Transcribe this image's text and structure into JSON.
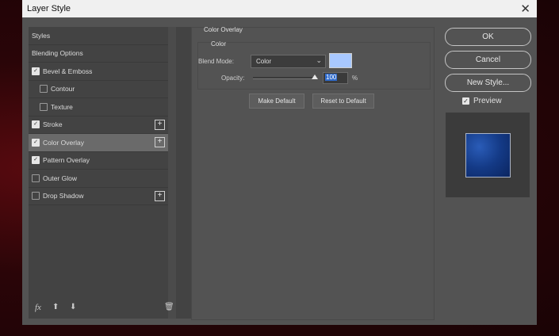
{
  "dialog": {
    "title": "Layer Style"
  },
  "styles_list": [
    {
      "label": "Styles",
      "checkbox": false,
      "checked": false,
      "indent": 0,
      "plus": false,
      "selected": false
    },
    {
      "label": "Blending Options",
      "checkbox": false,
      "checked": false,
      "indent": 0,
      "plus": false,
      "selected": false
    },
    {
      "label": "Bevel & Emboss",
      "checkbox": true,
      "checked": true,
      "indent": 0,
      "plus": false,
      "selected": false
    },
    {
      "label": "Contour",
      "checkbox": true,
      "checked": false,
      "indent": 1,
      "plus": false,
      "selected": false
    },
    {
      "label": "Texture",
      "checkbox": true,
      "checked": false,
      "indent": 1,
      "plus": false,
      "selected": false
    },
    {
      "label": "Stroke",
      "checkbox": true,
      "checked": true,
      "indent": 0,
      "plus": true,
      "selected": false
    },
    {
      "label": "Color Overlay",
      "checkbox": true,
      "checked": true,
      "indent": 0,
      "plus": true,
      "selected": true
    },
    {
      "label": "Pattern Overlay",
      "checkbox": true,
      "checked": true,
      "indent": 0,
      "plus": false,
      "selected": false
    },
    {
      "label": "Outer Glow",
      "checkbox": true,
      "checked": false,
      "indent": 0,
      "plus": false,
      "selected": false
    },
    {
      "label": "Drop Shadow",
      "checkbox": true,
      "checked": false,
      "indent": 0,
      "plus": true,
      "selected": false
    }
  ],
  "bottom_icons": {
    "fx": "fx",
    "up": "arrow-up-icon",
    "down": "arrow-down-icon",
    "trash": "trash-icon"
  },
  "color_overlay": {
    "section_title": "Color Overlay",
    "group_title": "Color",
    "blend_mode_label": "Blend Mode:",
    "blend_mode_value": "Color",
    "swatch_color": "#a8c8ff",
    "opacity_label": "Opacity:",
    "opacity_value": "100",
    "opacity_unit": "%",
    "opacity_fraction": 1.0,
    "make_default": "Make Default",
    "reset_default": "Reset to Default"
  },
  "right": {
    "ok": "OK",
    "cancel": "Cancel",
    "new_style": "New Style...",
    "preview_label": "Preview",
    "preview_checked": true
  }
}
